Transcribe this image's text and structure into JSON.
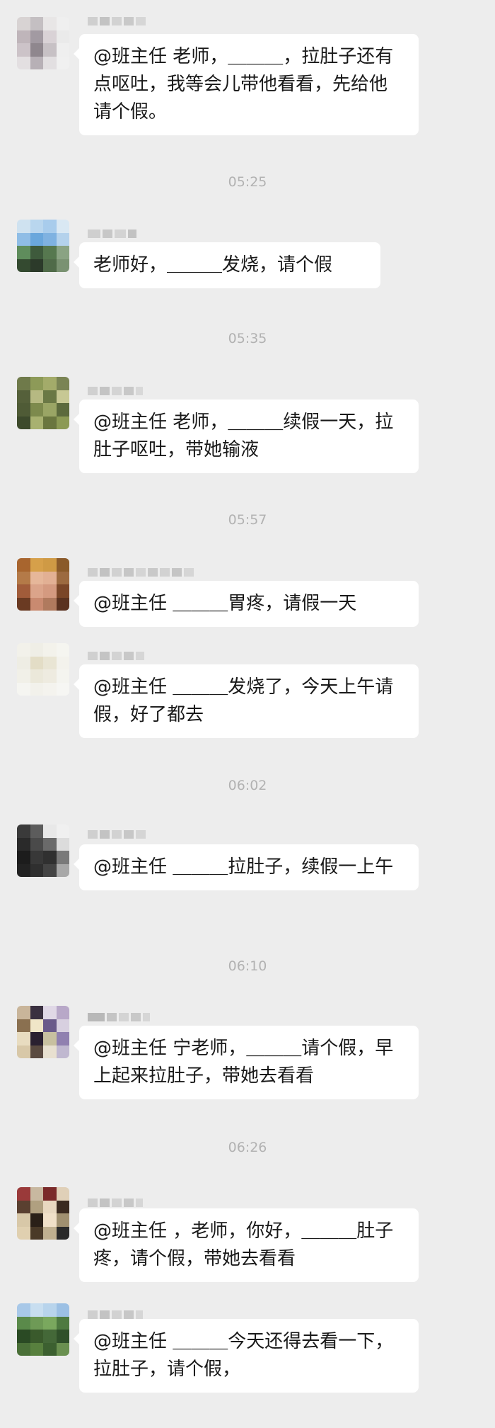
{
  "timestamps": [
    "05:25",
    "05:35",
    "05:57",
    "06:02",
    "06:10",
    "06:26"
  ],
  "messages": [
    {
      "text": "@班主任 老师，＿＿＿，拉肚子还有点呕吐，我等会儿带他看看，先给他请个假。"
    },
    {
      "text": "老师好，＿＿＿发烧，请个假"
    },
    {
      "text": "@班主任 老师，＿＿＿续假一天，拉肚子呕吐，带她输液"
    },
    {
      "text": "@班主任 ＿＿＿胃疼，请假一天"
    },
    {
      "text": "@班主任 ＿＿＿发烧了，今天上午请假，好了都去"
    },
    {
      "text": "@班主任 ＿＿＿拉肚子，续假一上午"
    },
    {
      "text": "@班主任 宁老师，＿＿＿请个假，早上起来拉肚子，带她去看看"
    },
    {
      "text": "@班主任 ，老师，你好，＿＿＿肚子疼，请个假，带她去看看"
    },
    {
      "text": "@班主任 ＿＿＿今天还得去看一下，拉肚子，请个假，"
    }
  ]
}
